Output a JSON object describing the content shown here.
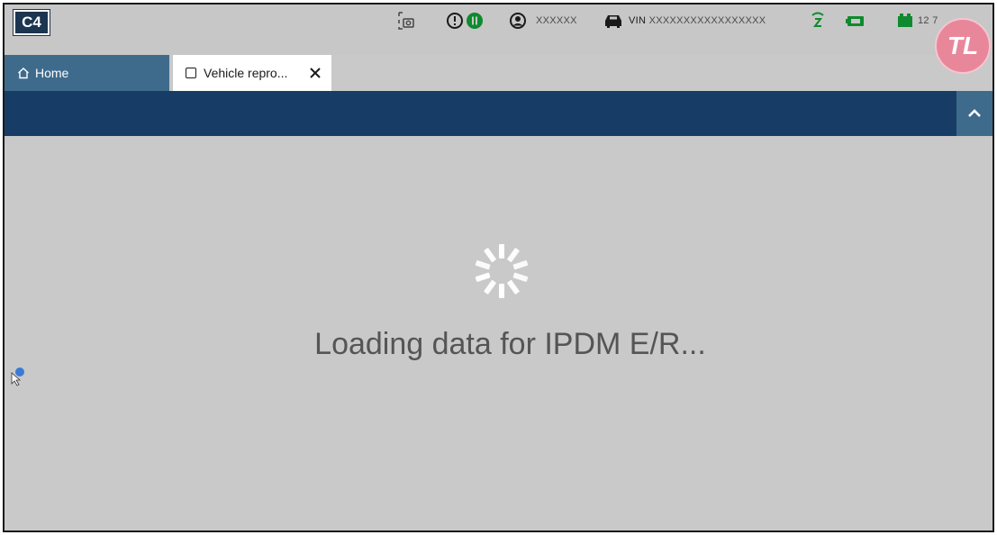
{
  "app": {
    "logo": "C4"
  },
  "status_bar": {
    "user_name": "XXXXXX",
    "vin_prefix": "VIN",
    "vin_value": "XXXXXXXXXXXXXXXXX",
    "battery_voltage": "12 7"
  },
  "tabs": [
    {
      "label": "Home",
      "icon": "home-icon",
      "active": false
    },
    {
      "label": "Vehicle repro...",
      "icon": "window-icon",
      "active": true
    }
  ],
  "navbar": {
    "collapse_icon": "chevron-up-icon"
  },
  "main": {
    "loading_text": "Loading data for IPDM E/R..."
  },
  "badge": {
    "text": "TL"
  },
  "colors": {
    "navbar": "#173d66",
    "tab_inactive": "#3e6b8c",
    "status_green": "#0f8a2e",
    "badge_pink": "#e9879a"
  }
}
